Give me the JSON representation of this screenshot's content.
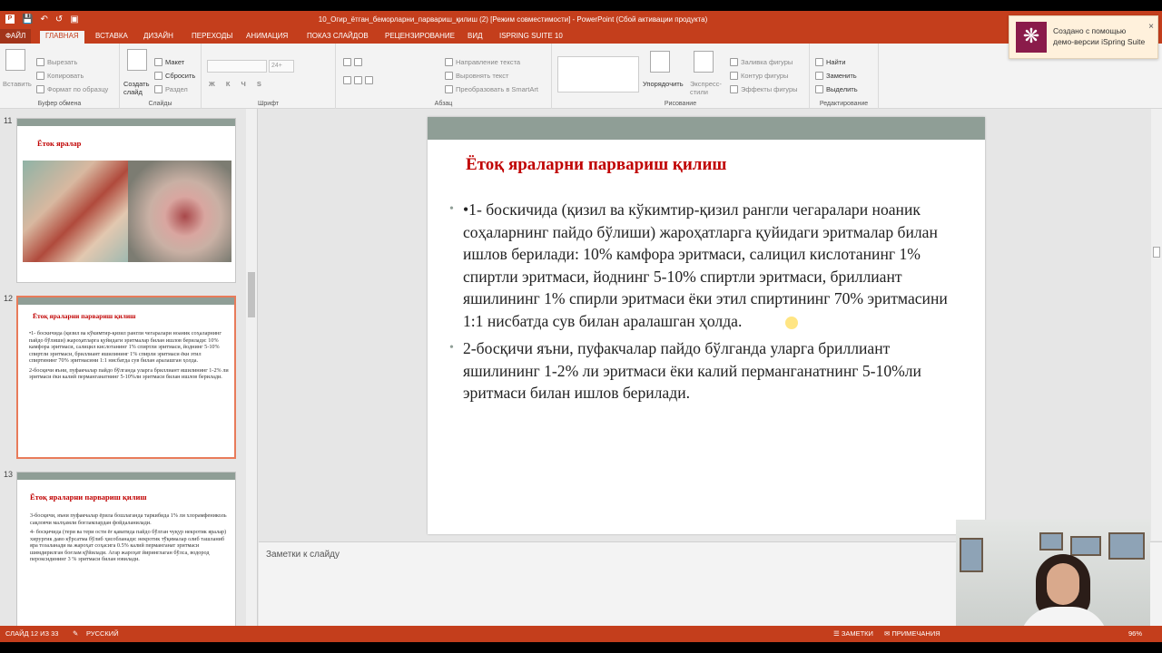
{
  "window": {
    "title": "10_Огир_ётган_беморларни_парвариш_қилиш (2) [Режим совместимости] - PowerPoint (Сбой активации продукта)"
  },
  "tabs": [
    "ФАЙЛ",
    "ГЛАВНАЯ",
    "ВСТАВКА",
    "ДИЗАЙН",
    "ПЕРЕХОДЫ",
    "АНИМАЦИЯ",
    "ПОКАЗ СЛАЙДОВ",
    "РЕЦЕНЗИРОВАНИЕ",
    "ВИД",
    "ISPRING SUITE 10"
  ],
  "ribbon": {
    "clipboard": {
      "paste": "Вставить",
      "cut": "Вырезать",
      "copy": "Копировать",
      "format_painter": "Формат по образцу",
      "label": "Буфер обмена"
    },
    "slides": {
      "new_slide": "Создать слайд",
      "layout": "Макет",
      "reset": "Сбросить",
      "section": "Раздел",
      "label": "Слайды"
    },
    "font": {
      "size": "24+",
      "label": "Шрифт"
    },
    "paragraph": {
      "text_direction": "Направление текста",
      "align_text": "Выровнять текст",
      "smartart": "Преобразовать в SmartArt",
      "label": "Абзац"
    },
    "drawing": {
      "arrange": "Упорядочить",
      "quick_styles": "Экспресс-стили",
      "fill": "Заливка фигуры",
      "outline": "Контур фигуры",
      "effects": "Эффекты фигуры",
      "label": "Рисование"
    },
    "editing": {
      "find": "Найти",
      "replace": "Заменить",
      "select": "Выделить",
      "label": "Редактирование"
    }
  },
  "toast": {
    "line1": "Создано с помощью",
    "line2": "демо-версии iSpring Suite"
  },
  "thumbnails": [
    {
      "num": "11",
      "title": "Ёток яралар",
      "bullets": []
    },
    {
      "num": "12",
      "title": "Ётоқ яраларни парвариш қилиш",
      "bullets": [
        "•1- боскичида (қизил ва кўкимтир-қизил рангли чегаралари ноаник соҳаларнинг пайдо бўлиши) жароҳатларга қуйидаги эритмалар билан ишлов берилади: 10% камфора эритмаси, салицил кислотанинг 1% спиртли эритмаси, йоднинг 5-10% спиртли эритмаси, бриллиант яшилининг 1% спирли эритмаси ёки этил спиртининг 70% эритмасини 1:1 нисбатда сув билан аралашган ҳолда.",
        "2-босқичи яъни, пуфакчалар пайдо бўлганда уларга бриллиант яшилининг 1-2% ли эритмаси ёки калий перманганатнинг 5-10%ли эритмаси билан ишлов берилади."
      ]
    },
    {
      "num": "13",
      "title": "Ётоқ яраларни парвариш қилиш",
      "bullets": [
        "3-босқичи, яъни пуфакчалар ёрила бошлаганда таркибида 1% ли хлорамфениколь сақловчи малҳамли боғламлардан фойдаланилади.",
        "4- босқичида (тери ва тери ости ёғ қаватида пайдо бўлган чуқур некротик яралар) хирургик даво кўрсатма бўлиб ҳисобланади: некротик тўқималар олиб ташланиб яра тозаланади ва жароҳат соҳасига 0.5% калий перманганат эритмаси шимдирилган боғлам қўйилади. Агар жароҳат йиринглаган бўлса, водород пероксидининг 3 % эритмаси билан ювилади."
      ]
    }
  ],
  "slide": {
    "title": "Ётоқ яраларни парвариш қилиш",
    "bullets": [
      "•1- боскичида (қизил ва кўкимтир-қизил рангли чегаралари ноаник соҳаларнинг пайдо бўлиши) жароҳатларга қуйидаги эритмалар билан ишлов берилади: 10% камфора эритмаси, салицил кислотанинг 1% спиртли эритмаси, йоднинг 5-10% спиртли эритмаси, бриллиант яшилининг 1% спирли эритмаси ёки этил спиртининг 70% эритмасини 1:1 нисбатда сув билан аралашган ҳолда.",
      "2-босқичи яъни, пуфакчалар пайдо бўлганда уларга бриллиант яшилининг 1-2% ли эритмаси ёки калий перманганатнинг 5-10%ли эритмаси билан ишлов берилади."
    ]
  },
  "notes_placeholder": "Заметки к слайду",
  "status": {
    "slide": "СЛАЙД 12 ИЗ 33",
    "language": "РУССКИЙ",
    "notes": "ЗАМЕТКИ",
    "comments": "ПРИМЕЧАНИЯ",
    "zoom": "96%"
  },
  "colors": {
    "accent": "#c43e1c",
    "title_red": "#c00000",
    "slide_bar": "#8f9e96"
  }
}
